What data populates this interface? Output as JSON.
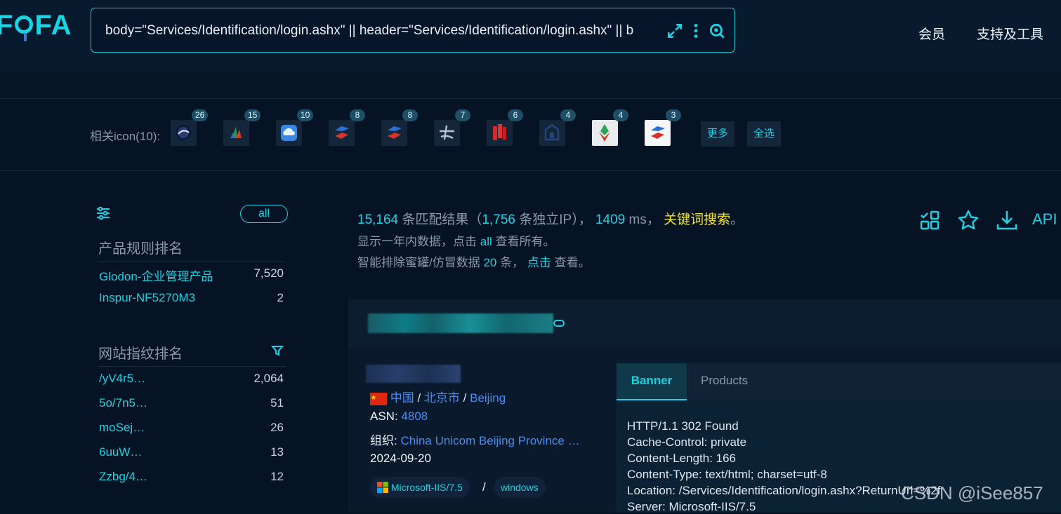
{
  "header": {
    "logo": "FOFA",
    "query": "body=\"Services/Identification/login.ashx\" || header=\"Services/Identification/login.ashx\" || b",
    "nav": [
      "会员",
      "支持及工具"
    ]
  },
  "icons": {
    "label": "相关icon(10):",
    "badges": [
      "26",
      "15",
      "10",
      "8",
      "8",
      "7",
      "6",
      "4",
      "4",
      "3"
    ],
    "more": "更多",
    "select_all": "全选"
  },
  "sidebar": {
    "all_label": "all",
    "products_title": "产品规则排名",
    "products": [
      {
        "label": "Glodon-企业管理产品",
        "count": "7,520"
      },
      {
        "label": "Inspur-NF5270M3",
        "count": "2"
      }
    ],
    "fingerprints_title": "网站指纹排名",
    "fingerprints": [
      {
        "label": "/yV4r5…",
        "count": "2,064"
      },
      {
        "label": "5o/7n5…",
        "count": "51"
      },
      {
        "label": "moSej…",
        "count": "26"
      },
      {
        "label": "6uuW…",
        "count": "13"
      },
      {
        "label": "Zzbg/4…",
        "count": "12"
      }
    ]
  },
  "summary": {
    "matches": "15,164",
    "matches_suffix": "条匹配结果（",
    "ips": "1,756",
    "ips_suffix": "条独立IP），",
    "ms": "1409",
    "ms_suffix": "ms，",
    "keyword": "关键词搜索",
    "end": "。",
    "line2_prefix": "显示一年内数据，点击",
    "line2_link": "all",
    "line2_suffix": "查看所有。",
    "line3_prefix": "智能排除蜜罐/仿冒数据",
    "line3_count": "20",
    "line3_mid": "条，",
    "line3_link": "点击",
    "line3_suffix": "查看。",
    "api": "API"
  },
  "result": {
    "country": "中国",
    "region": "北京市",
    "city": "Beijing",
    "asn_label": "ASN:",
    "asn": "4808",
    "org_label": "组织:",
    "org": "China Unicom Beijing Province …",
    "date": "2024-09-20",
    "tags": [
      "Microsoft-IIS/7.5",
      "windows"
    ],
    "tag_sep": "/",
    "tabs": [
      "Banner",
      "Products"
    ],
    "banner": [
      "HTTP/1.1 302 Found",
      "Cache-Control: private",
      "Content-Length: 166",
      "Content-Type: text/html; charset=utf-8",
      "Location: /Services/Identification/login.ashx?ReturnUrl=%2f",
      "Server: Microsoft-IIS/7.5"
    ]
  },
  "watermark": "CSDN @iSee857"
}
